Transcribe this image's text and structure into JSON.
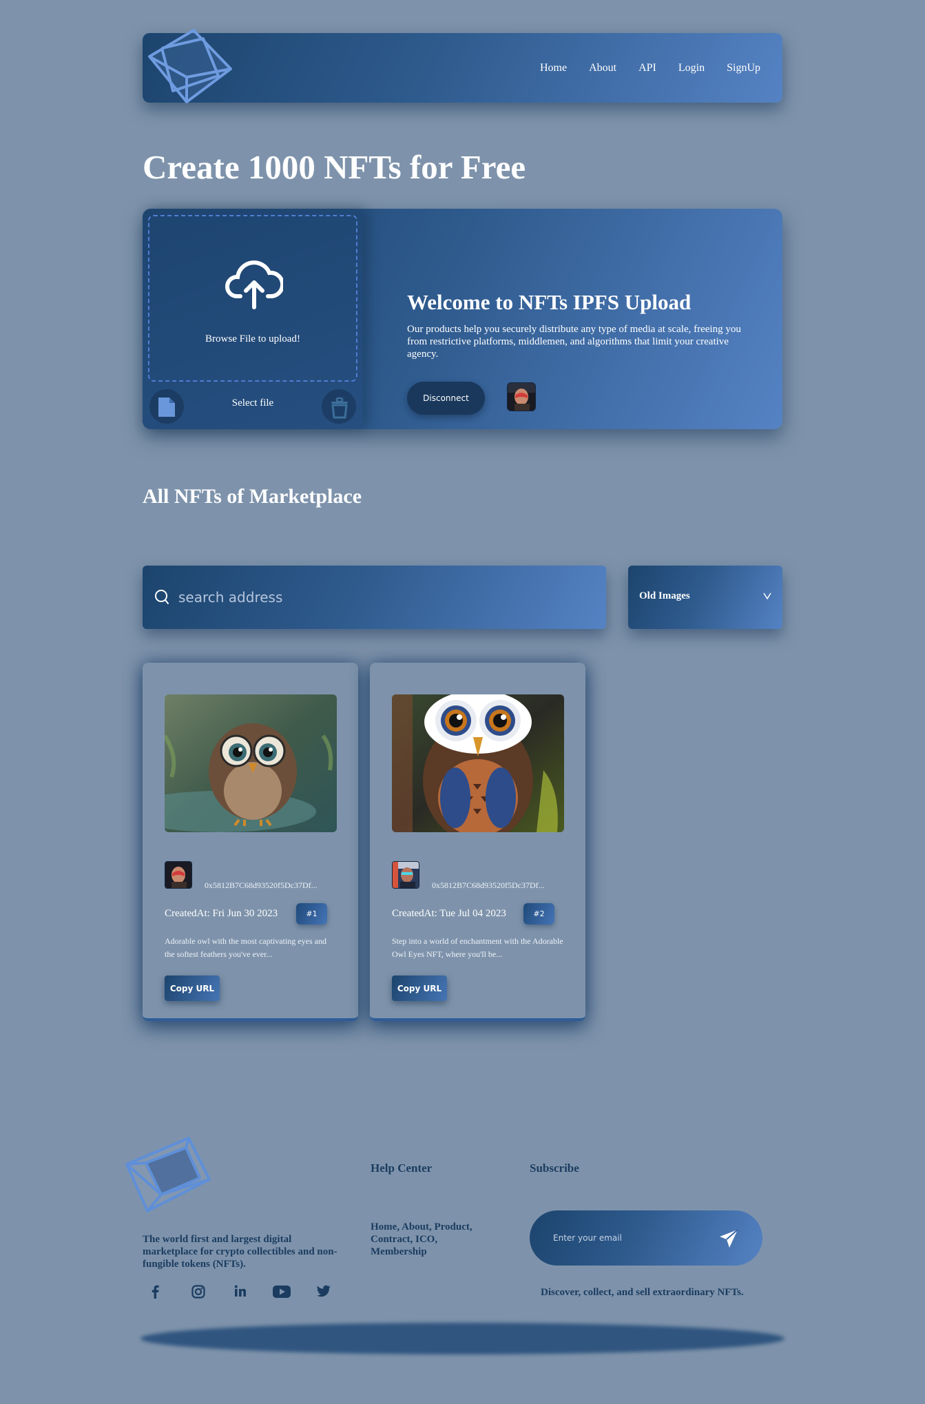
{
  "navbar": {
    "links": [
      "Home",
      "About",
      "API",
      "Login",
      "SignUp"
    ]
  },
  "hero": {
    "title": "Create 1000 NFTs for Free"
  },
  "upload": {
    "browse_label": "Browse File to upload!",
    "select_label": "Select file",
    "welcome_title": "Welcome to NFTs IPFS Upload",
    "welcome_text": "Our products help you securely distribute any type of media at scale, freeing you from restrictive platforms, middlemen, and algorithms that limit your creative agency.",
    "disconnect_label": "Disconnect"
  },
  "marketplace": {
    "title": "All NFTs of Marketplace",
    "search_placeholder": "search address",
    "filter_value": "Old Images",
    "cards": [
      {
        "address": "0x5812B7C68d93520f5Dc37Df...",
        "created": "CreatedAt: Fri Jun 30 2023",
        "badge": "#1",
        "description": "Adorable owl with the most captivating eyes and the softest feathers you've ever...",
        "button": "Copy URL"
      },
      {
        "address": "0x5812B7C68d93520f5Dc37Df...",
        "created": "CreatedAt: Tue Jul 04 2023",
        "badge": "#2",
        "description": "Step into a world of enchantment with the Adorable Owl Eyes NFT, where you'll be...",
        "button": "Copy URL"
      }
    ]
  },
  "footer": {
    "tagline": "The world first and largest digital marketplace for crypto collectibles and non-fungible tokens (NFTs).",
    "help_title": "Help Center",
    "help_links": "Home, About, Product, Contract, ICO, Membership",
    "subscribe_title": "Subscribe",
    "email_placeholder": "Enter your email",
    "slogan": "Discover, collect, and sell extraordinary NFTs.",
    "social_icons": [
      "facebook-icon",
      "instagram-icon",
      "linkedin-icon",
      "youtube-icon",
      "twitter-icon"
    ]
  },
  "colors": {
    "background": "#7e93ab",
    "gradient_start": "#1c446d",
    "gradient_end": "#5582c3",
    "footer_text": "#1b3c60"
  }
}
